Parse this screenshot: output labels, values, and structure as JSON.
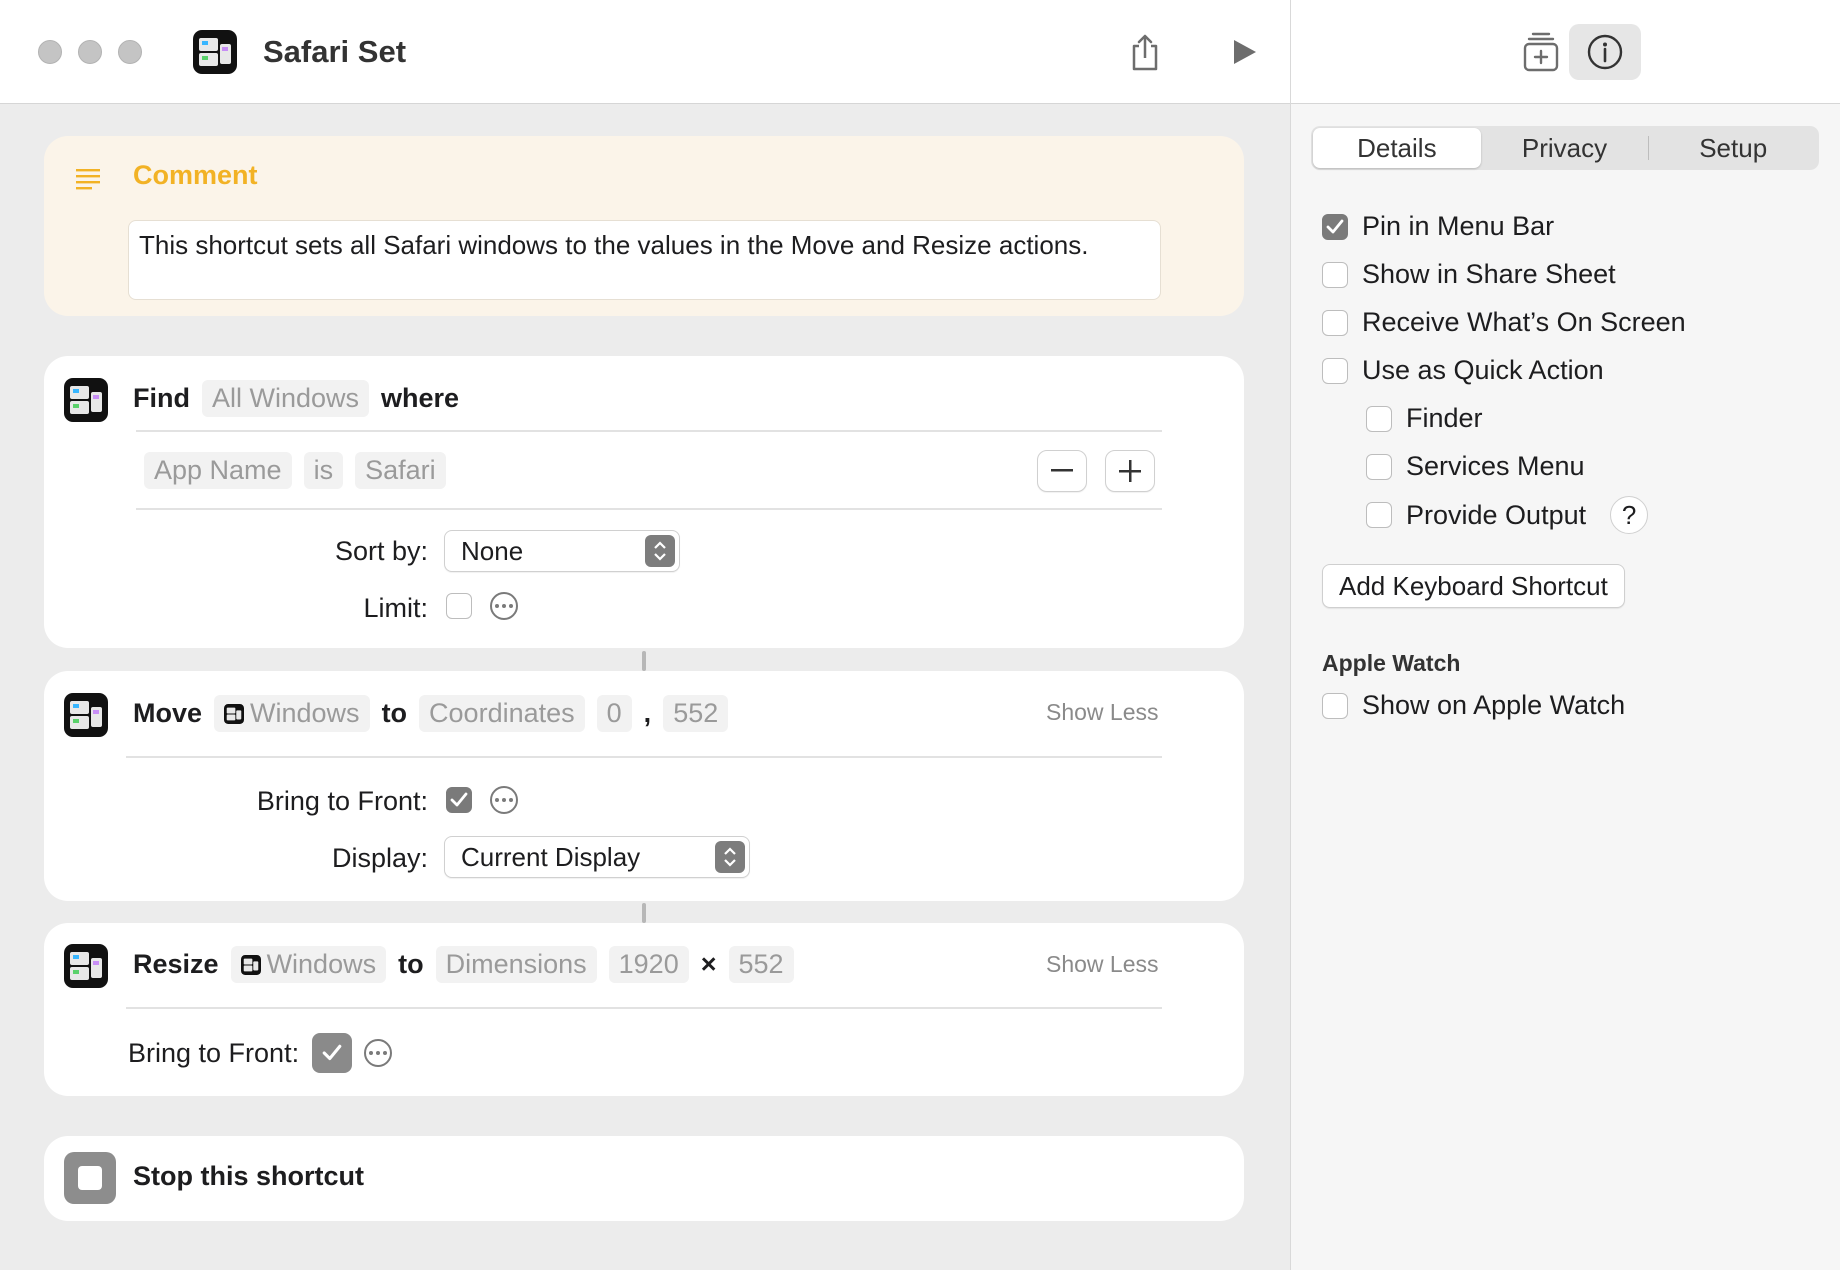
{
  "window": {
    "title": "Safari Set"
  },
  "toolbar": {
    "share_icon": "share-icon",
    "run_icon": "play-icon",
    "library_icon": "add-to-library-icon",
    "info_icon": "info-icon"
  },
  "comment": {
    "title": "Comment",
    "text": "This shortcut sets all Safari windows to the values in the Move and Resize actions."
  },
  "find": {
    "keyword": "Find",
    "subject": "All Windows",
    "where": "where",
    "filter": {
      "field": "App Name",
      "op": "is",
      "value": "Safari"
    },
    "sort_label": "Sort by:",
    "sort_value": "None",
    "limit_label": "Limit:"
  },
  "move": {
    "keyword": "Move",
    "subject": "Windows",
    "to": "to",
    "mode": "Coordinates",
    "x": "0",
    "comma": ",",
    "y": "552",
    "show_less": "Show Less",
    "bring_front_label": "Bring to Front:",
    "display_label": "Display:",
    "display_value": "Current Display"
  },
  "resize": {
    "keyword": "Resize",
    "subject": "Windows",
    "to": "to",
    "mode": "Dimensions",
    "w": "1920",
    "times": "×",
    "h": "552",
    "show_less": "Show Less",
    "bring_front_label": "Bring to Front:"
  },
  "stop": {
    "label": "Stop this shortcut"
  },
  "inspector": {
    "tabs": [
      {
        "label": "Details",
        "active": true
      },
      {
        "label": "Privacy",
        "active": false
      },
      {
        "label": "Setup",
        "active": false
      }
    ],
    "options": {
      "pin_menu_bar": "Pin in Menu Bar",
      "share_sheet": "Show in Share Sheet",
      "receive_screen": "Receive What’s On Screen",
      "quick_action": "Use as Quick Action",
      "finder": "Finder",
      "services_menu": "Services Menu",
      "provide_output": "Provide Output",
      "help": "?"
    },
    "keyboard_shortcut": "Add Keyboard Shortcut",
    "apple_watch_heading": "Apple Watch",
    "show_on_watch": "Show on Apple Watch"
  },
  "colors": {
    "comment_accent": "#f2b225",
    "comment_bg": "#fbf4e9"
  }
}
